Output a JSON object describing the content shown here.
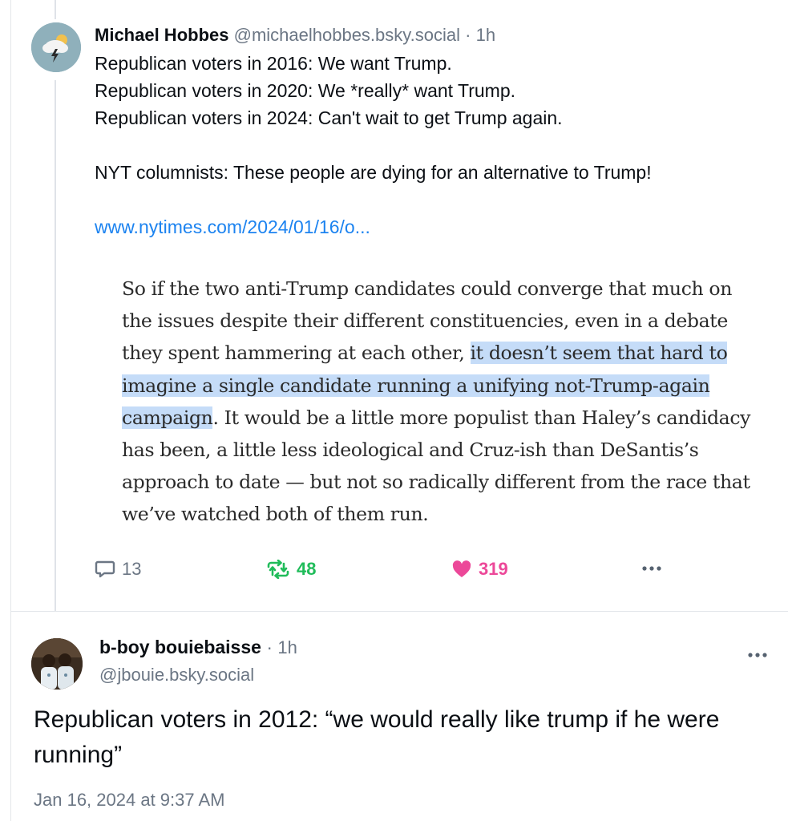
{
  "post1": {
    "author_name": "Michael Hobbes",
    "handle": "@michaelhobbes.bsky.social",
    "separator": "·",
    "time": "1h",
    "lines": [
      "Republican voters in 2016: We want Trump.",
      "Republican voters in 2020: We *really* want Trump.",
      "Republican voters in 2024: Can't wait to get Trump again."
    ],
    "line_after_gap": "NYT columnists: These people are dying for an alternative to Trump!",
    "link_text": "www.nytimes.com/2024/01/16/o...",
    "quote": {
      "l1": "So if the two anti-Trump candidates could converge that much on",
      "l2": "the issues despite their different constituencies, even in a debate",
      "l3_plain": "they spent hammering at each other, ",
      "l3_hl": "it doesn’t seem that hard to",
      "l4_hl": "imagine a single candidate running a unifying not-Trump-again",
      "l5_hl": "campaign",
      "l5_plain": ". It would be a little more populist than Haley’s candidacy",
      "l6": "has been, a little less ideological and Cruz-ish than DeSantis’s",
      "l7": "approach to date — but not so radically different from the race that",
      "l8": "we’ve watched both of them run."
    },
    "actions": {
      "replies": "13",
      "reposts": "48",
      "likes": "319"
    }
  },
  "post2": {
    "author_name": "b-boy bouiebaisse",
    "separator": "·",
    "time": "1h",
    "handle": "@jbouie.bsky.social",
    "text": "Republican voters in 2012: “we would really like trump if he were running”",
    "date": "Jan 16, 2024 at 9:37 AM"
  },
  "colors": {
    "link": "#1c83f0",
    "repost": "#20bc5a",
    "like": "#ec4899",
    "highlight": "#c5dcf8",
    "muted": "#6b7684"
  },
  "icons": [
    "reply-bubble-icon",
    "repost-icon",
    "heart-icon",
    "more-icon"
  ]
}
